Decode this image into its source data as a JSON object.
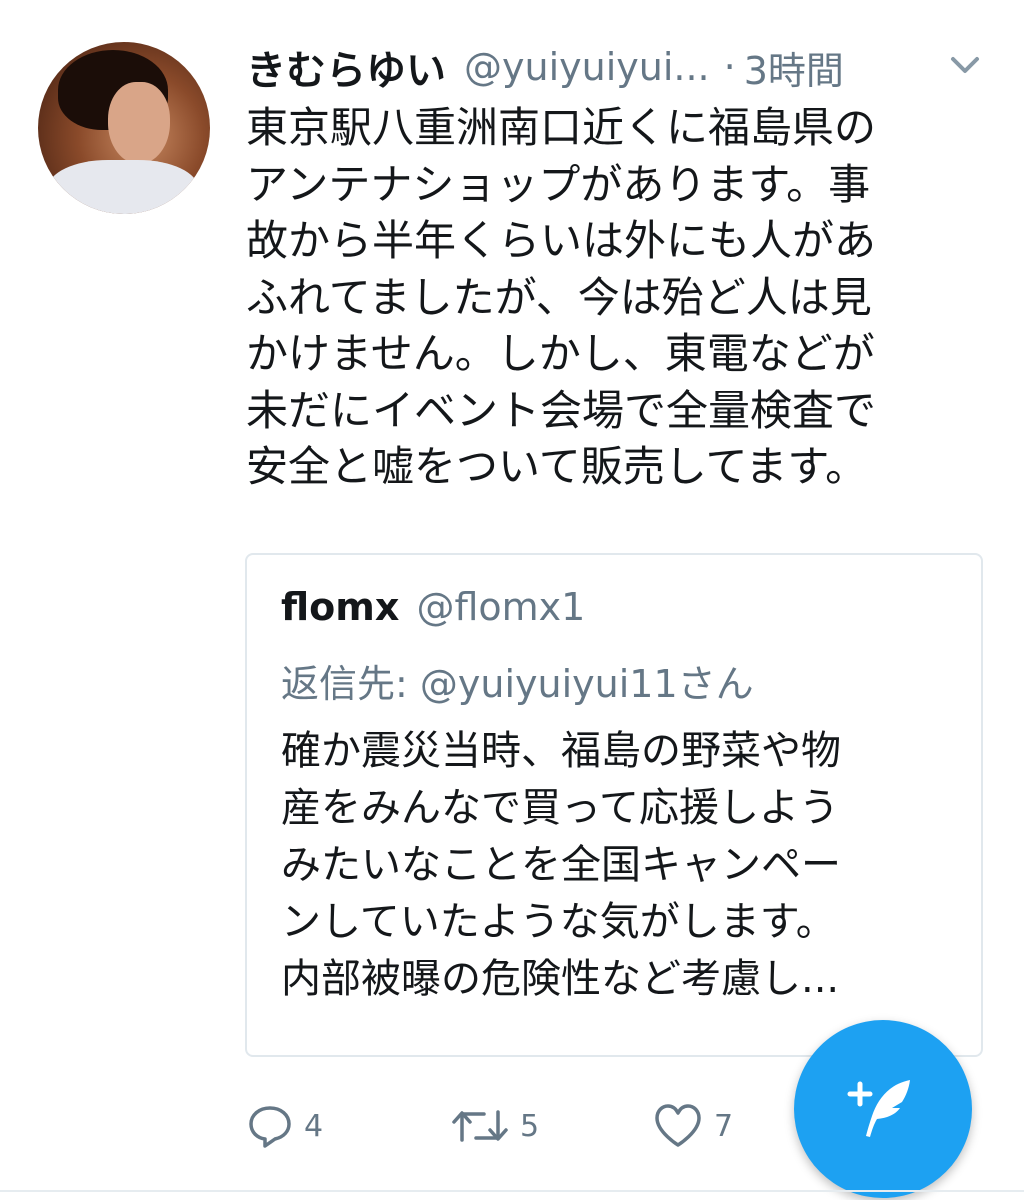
{
  "tweet": {
    "author_name": "きむらゆい",
    "author_handle": "@yuiyuiyui...",
    "separator": "·",
    "time": "3時間",
    "text_lines": [
      "東京駅八重洲南口近くに福島県の",
      "アンテナショップがあります。事",
      "故から半年くらいは外にも人があ",
      "ふれてましたが、今は殆ど人は見",
      "かけません。しかし、東電などが",
      "未だにイベント会場で全量検査で",
      "安全と嘘をついて販売してます。"
    ]
  },
  "quoted": {
    "author_name": "flomx",
    "author_handle": "@flomx1",
    "reply_to": "返信先: @yuiyuiyui11さん",
    "text_lines": [
      "確か震災当時、福島の野菜や物",
      "産をみんなで買って応援しよう",
      "みたいなことを全国キャンペー",
      "ンしていたような気がします。",
      "内部被曝の危険性など考慮し..."
    ]
  },
  "actions": {
    "reply_count": "4",
    "retweet_count": "5",
    "like_count": "7"
  },
  "icons": {
    "avatar": "profile-photo",
    "menu": "chevron-down-icon",
    "reply": "reply-icon",
    "retweet": "retweet-icon",
    "like": "heart-icon",
    "compose": "compose-feather-icon"
  },
  "colors": {
    "accent": "#1da1f2",
    "secondary_text": "#657786",
    "border": "#e1e8ed"
  }
}
